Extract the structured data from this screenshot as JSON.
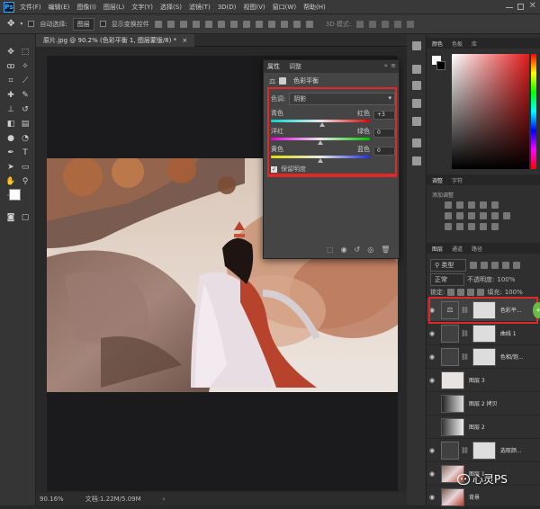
{
  "menubar": {
    "logo": "Ps",
    "items": [
      "文件(F)",
      "编辑(E)",
      "图像(I)",
      "图层(L)",
      "文字(Y)",
      "选择(S)",
      "滤镜(T)",
      "3D(D)",
      "视图(V)",
      "窗口(W)",
      "帮助(H)"
    ]
  },
  "options": {
    "auto_select_label": "自动选择:",
    "auto_select_value": "图层",
    "show_transform_label": "显示变换控件",
    "mode_3d_label": "3D 模式:"
  },
  "document": {
    "tab_title": "原片.jpg @ 90.2% (色彩平衡 1, 图层蒙版/8) *"
  },
  "status": {
    "zoom": "90.16%",
    "doc_info": "文档:1.22M/5.09M"
  },
  "properties": {
    "tabs": [
      "属性",
      "调整"
    ],
    "adjustment_title": "色彩平衡",
    "tone_label": "色调:",
    "tone_value": "阴影",
    "sliders": [
      {
        "left": "青色",
        "right": "红色",
        "value": "+3",
        "level": 3
      },
      {
        "left": "洋红",
        "right": "绿色",
        "value": "0",
        "level": 0
      },
      {
        "left": "黄色",
        "right": "蓝色",
        "value": "0",
        "level": 0
      }
    ],
    "preserve_luminosity_label": "保留明度"
  },
  "color_panel": {
    "tabs": [
      "颜色",
      "色板",
      "库"
    ]
  },
  "adjust_panel": {
    "tabs": [
      "调整",
      "字符"
    ],
    "add_label": "添加调整"
  },
  "layers_panel": {
    "tabs": [
      "图层",
      "通道",
      "路径"
    ],
    "kind_label": "类型",
    "blend_mode": "正常",
    "opacity_label": "不透明度:",
    "opacity_value": "100%",
    "lock_label": "锁定:",
    "fill_label": "填充:",
    "fill_value": "100%",
    "layers": [
      {
        "name": "色彩平...",
        "type": "adjust"
      },
      {
        "name": "曲线 1",
        "type": "adjust"
      },
      {
        "name": "色相/饱...",
        "type": "adjust"
      },
      {
        "name": "图层 3",
        "type": "pixel"
      },
      {
        "name": "图层 2 拷贝",
        "type": "pixel"
      },
      {
        "name": "图层 2",
        "type": "pixel"
      },
      {
        "name": "选取颜...",
        "type": "adjust"
      },
      {
        "name": "图层 1",
        "type": "pixel"
      },
      {
        "name": "背景",
        "type": "pixel"
      }
    ]
  },
  "watermark": {
    "text": "心灵PS"
  },
  "colors": {
    "highlight_red": "#e02828",
    "ui_dark": "#282828",
    "panel": "#454545"
  }
}
